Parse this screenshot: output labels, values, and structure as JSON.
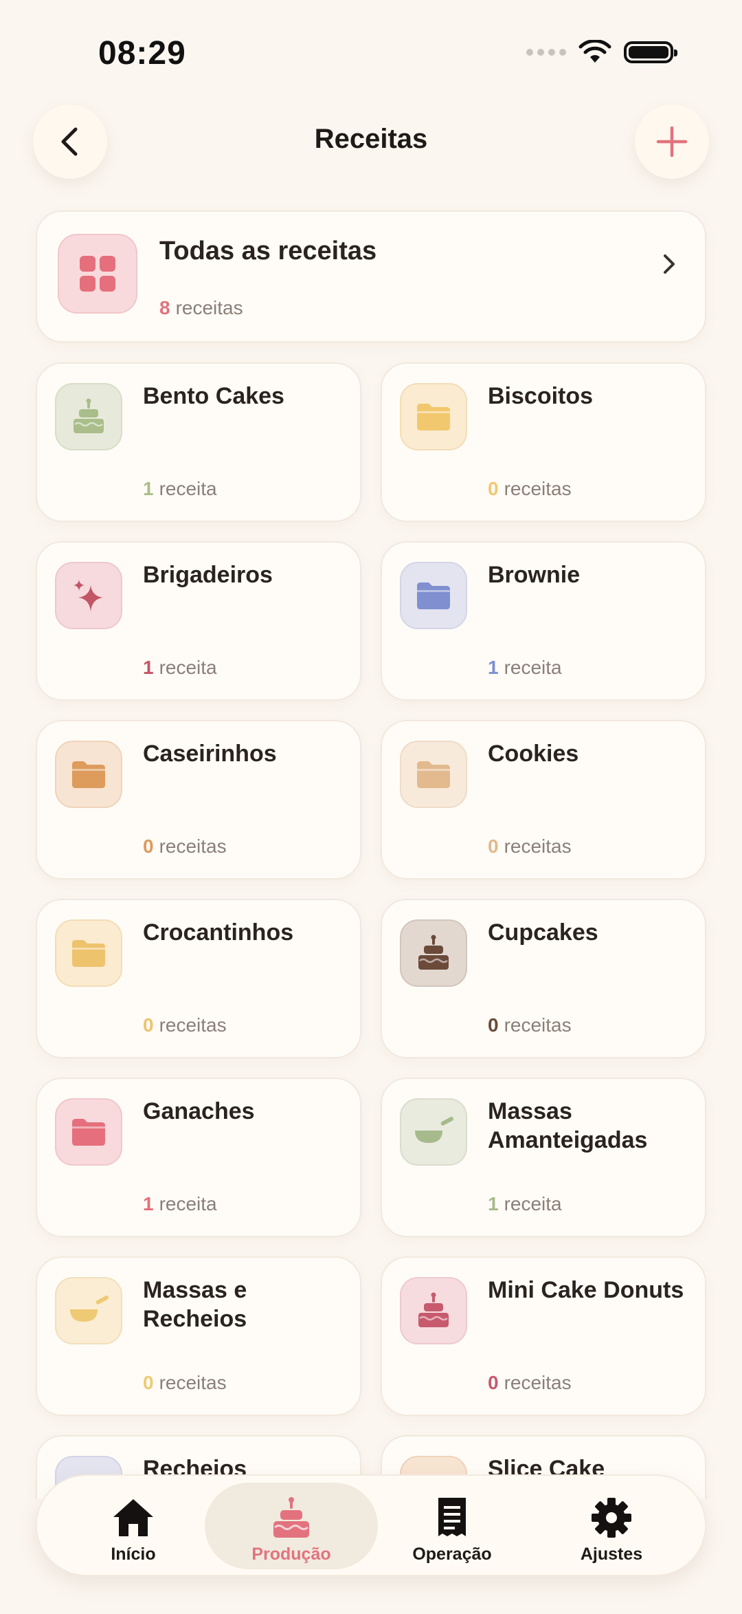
{
  "status": {
    "time": "08:29"
  },
  "header": {
    "title": "Receitas"
  },
  "all_recipes": {
    "title": "Todas as receitas",
    "count": "8",
    "unit": "receitas"
  },
  "categories": [
    {
      "name": "Bento Cakes",
      "count": "1",
      "unit": "receita",
      "icon": "cake-icon",
      "tile_bg": "#E7EADB",
      "tile_border": "#D8DDC7",
      "color": "#A9BE8A"
    },
    {
      "name": "Biscoitos",
      "count": "0",
      "unit": "receitas",
      "icon": "folder-icon",
      "tile_bg": "#FBEBD0",
      "tile_border": "#F2DDB7",
      "color": "#F2C86F"
    },
    {
      "name": "Brigadeiros",
      "count": "1",
      "unit": "receita",
      "icon": "sparkles-icon",
      "tile_bg": "#F6DADD",
      "tile_border": "#EDC8CC",
      "color": "#C25667"
    },
    {
      "name": "Brownie",
      "count": "1",
      "unit": "receita",
      "icon": "folder-icon",
      "tile_bg": "#E4E4F0",
      "tile_border": "#D3D4E6",
      "color": "#7F8FD0"
    },
    {
      "name": "Caseirinhos",
      "count": "0",
      "unit": "receitas",
      "icon": "folder-icon",
      "tile_bg": "#F8E4D2",
      "tile_border": "#EFD3BB",
      "color": "#DD9B5C"
    },
    {
      "name": "Cookies",
      "count": "0",
      "unit": "receitas",
      "icon": "folder-icon",
      "tile_bg": "#F8EADB",
      "tile_border": "#EEDCC8",
      "color": "#E2BA8D"
    },
    {
      "name": "Crocantinhos",
      "count": "0",
      "unit": "receitas",
      "icon": "folder-icon",
      "tile_bg": "#FBEBD0",
      "tile_border": "#F2DDB7",
      "color": "#EEC36E"
    },
    {
      "name": "Cupcakes",
      "count": "0",
      "unit": "receitas",
      "icon": "cake-icon",
      "tile_bg": "#E2D8D0",
      "tile_border": "#D2C6BC",
      "color": "#6B4A3A"
    },
    {
      "name": "Ganaches",
      "count": "1",
      "unit": "receita",
      "icon": "folder-icon",
      "tile_bg": "#F9DADC",
      "tile_border": "#F0C7CA",
      "color": "#E56F7C"
    },
    {
      "name": "Massas Amanteigadas",
      "count": "1",
      "unit": "receita",
      "icon": "pan-icon",
      "tile_bg": "#E9EBDF",
      "tile_border": "#DADDCC",
      "color": "#A7BA8C"
    },
    {
      "name": "Massas e Recheios",
      "count": "0",
      "unit": "receitas",
      "icon": "pan-icon",
      "tile_bg": "#FBEDD3",
      "tile_border": "#F2DFBC",
      "color": "#EFCA74"
    },
    {
      "name": "Mini Cake Donuts",
      "count": "0",
      "unit": "receitas",
      "icon": "cake-icon",
      "tile_bg": "#F6DCDF",
      "tile_border": "#EDCACE",
      "color": "#C75A6D"
    },
    {
      "name": "Recheios",
      "count": "",
      "unit": "",
      "icon": "folder-icon",
      "tile_bg": "#E4E4F0",
      "tile_border": "#D3D4E6",
      "color": "#9CA6E0"
    },
    {
      "name": "Slice Cake",
      "count": "",
      "unit": "",
      "icon": "folder-icon",
      "tile_bg": "#F8E4D2",
      "tile_border": "#EFD3BB",
      "color": "#EFC36F"
    }
  ],
  "tabs": [
    {
      "label": "Início",
      "icon": "home-icon",
      "active": false
    },
    {
      "label": "Produção",
      "icon": "cake-icon",
      "active": true
    },
    {
      "label": "Operação",
      "icon": "receipt-icon",
      "active": false
    },
    {
      "label": "Ajustes",
      "icon": "gear-icon",
      "active": false
    }
  ],
  "colors": {
    "accent": "#E2737E",
    "background": "#FBF6F0"
  }
}
